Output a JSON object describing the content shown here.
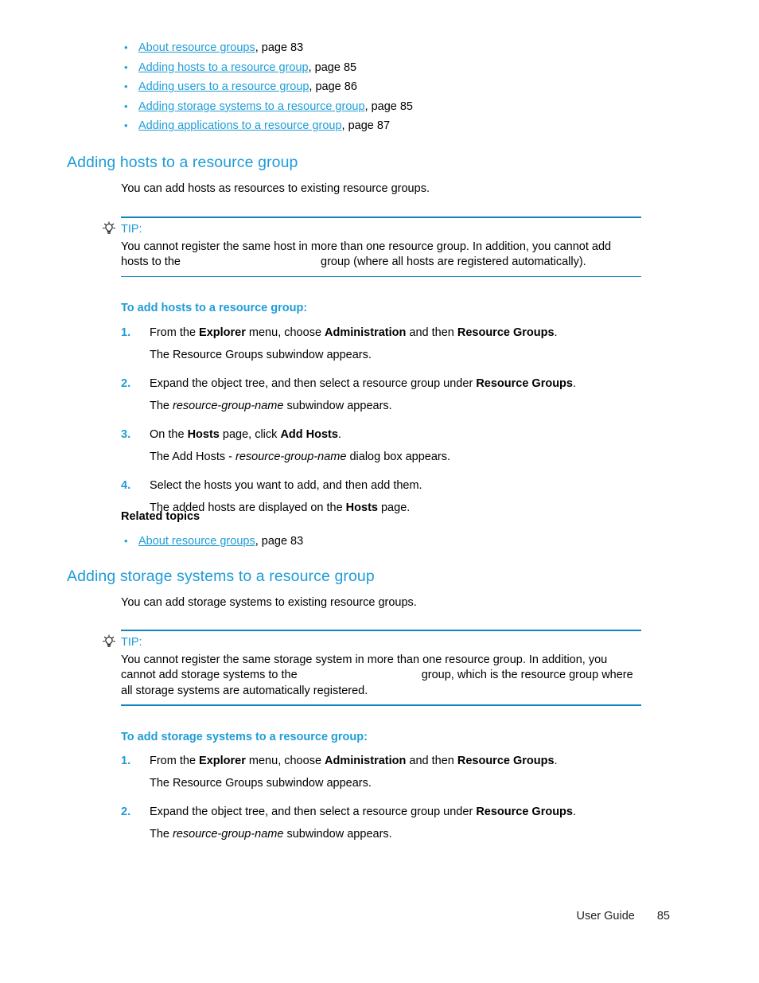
{
  "document": {
    "type": "user-guide-page",
    "accent_color": "#1f9cd7",
    "rule_color": "#1283bd",
    "text_color": "#000000",
    "background": "#ffffff"
  },
  "toc": {
    "items": [
      {
        "link": "About resource groups",
        "tail": ", page 83"
      },
      {
        "link": "Adding hosts to a resource group",
        "tail": ", page 85"
      },
      {
        "link": "Adding users to a resource group",
        "tail": ", page 86"
      },
      {
        "link": "Adding storage systems to a resource group",
        "tail": ", page 85"
      },
      {
        "link": "Adding applications to a resource group",
        "tail": ", page 87"
      }
    ],
    "bullet_glyph": "•"
  },
  "section_hosts": {
    "heading": "Adding hosts to a resource group",
    "intro": "You can add hosts as resources to existing resource groups.",
    "tip": {
      "icon": "lightbulb-icon",
      "label": "TIP:",
      "body_part1": "You cannot register the same host in more than one resource group. In addition, you cannot add hosts to the ",
      "body_part2": " group (where all hosts are registered automatically)."
    },
    "procedure_title": "To add hosts to a resource group:",
    "steps": [
      {
        "num": "1.",
        "text_before_bold1": "From the ",
        "bold1": "Explorer",
        "text_mid1": " menu, choose ",
        "bold2": "Administration",
        "text_mid2": " and then ",
        "bold3": "Resource Groups",
        "text_after": ".",
        "result": "The Resource Groups subwindow appears."
      },
      {
        "num": "2.",
        "text_before_bold1": "Expand the object tree, and then select a resource group under ",
        "bold1": "Resource Groups",
        "text_after": ".",
        "result_before_italic": "The ",
        "result_italic": "resource-group-name",
        "result_after": " subwindow appears."
      },
      {
        "num": "3.",
        "text_before_bold1": "On the ",
        "bold1": "Hosts",
        "text_mid1": " page, click ",
        "bold2": "Add Hosts",
        "text_after": ".",
        "result_before_italic": "The Add Hosts - ",
        "result_italic": "resource-group-name",
        "result_after": " dialog box appears."
      },
      {
        "num": "4.",
        "text_plain": "Select the hosts you want to add, and then add them.",
        "result_before_bold": "The added hosts are displayed on the ",
        "result_bold": "Hosts",
        "result_after": " page."
      }
    ],
    "related": {
      "title": "Related topics",
      "items": [
        {
          "link": "About resource groups",
          "tail": ", page 83"
        }
      ]
    }
  },
  "section_storage": {
    "heading": "Adding storage systems to a resource group",
    "intro": "You can add storage systems to existing resource groups.",
    "tip": {
      "icon": "lightbulb-icon",
      "label": "TIP:",
      "body_part1": "You cannot register the same storage system in more than one resource group. In addition, you cannot add storage systems to the ",
      "body_part2": " group, which is the resource group where all storage systems are automatically registered."
    },
    "procedure_title": "To add storage systems to a resource group:",
    "steps": [
      {
        "num": "1.",
        "text_before_bold1": "From the ",
        "bold1": "Explorer",
        "text_mid1": " menu, choose ",
        "bold2": "Administration",
        "text_mid2": " and then ",
        "bold3": "Resource Groups",
        "text_after": ".",
        "result": "The Resource Groups subwindow appears."
      },
      {
        "num": "2.",
        "text_before_bold1": "Expand the object tree, and then select a resource group under ",
        "bold1": "Resource Groups",
        "text_after": ".",
        "result_before_italic": "The ",
        "result_italic": "resource-group-name",
        "result_after": " subwindow appears."
      }
    ]
  },
  "footer": {
    "guide_label": "User Guide",
    "page_number": "85"
  }
}
